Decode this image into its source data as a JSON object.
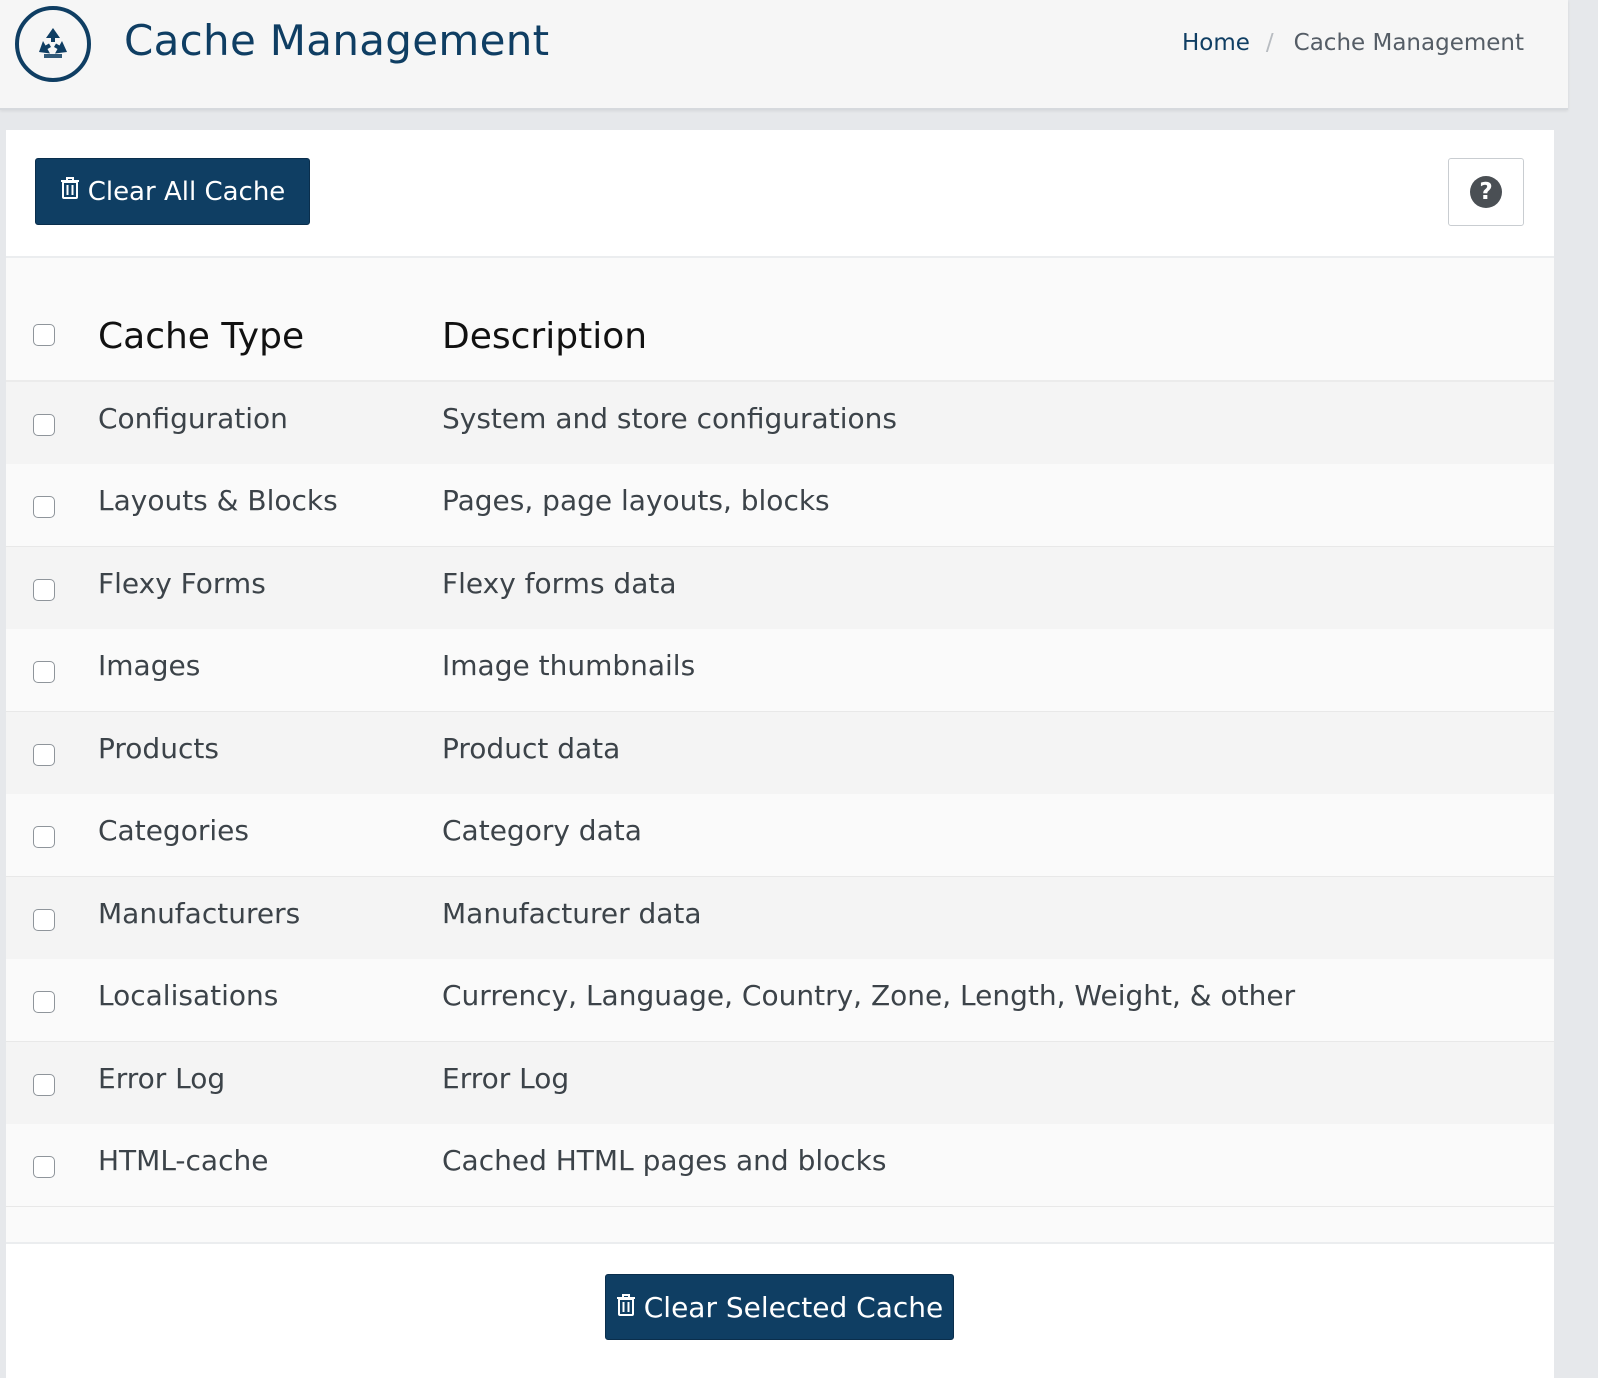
{
  "header": {
    "title": "Cache Management",
    "icon": "recycle-icon",
    "breadcrumb": {
      "home": "Home",
      "separator": "/",
      "current": "Cache Management"
    }
  },
  "toolbar": {
    "clear_all_label": "Clear All Cache",
    "clear_all_icon": "trash-icon",
    "help_icon": "question-circle-icon"
  },
  "table": {
    "columns": [
      "Cache Type",
      "Description"
    ],
    "rows": [
      {
        "type": "Configuration",
        "description": "System and store configurations",
        "checked": false
      },
      {
        "type": "Layouts & Blocks",
        "description": "Pages, page layouts, blocks",
        "checked": false
      },
      {
        "type": "Flexy Forms",
        "description": "Flexy forms data",
        "checked": false
      },
      {
        "type": "Images",
        "description": "Image thumbnails",
        "checked": false
      },
      {
        "type": "Products",
        "description": "Product data",
        "checked": false
      },
      {
        "type": "Categories",
        "description": "Category data",
        "checked": false
      },
      {
        "type": "Manufacturers",
        "description": "Manufacturer data",
        "checked": false
      },
      {
        "type": "Localisations",
        "description": "Currency, Language, Country, Zone, Length, Weight, & other",
        "checked": false
      },
      {
        "type": "Error Log",
        "description": "Error Log",
        "checked": false
      },
      {
        "type": "HTML-cache",
        "description": "Cached HTML pages and blocks",
        "checked": false
      }
    ]
  },
  "footer": {
    "clear_selected_label": "Clear Selected Cache"
  },
  "colors": {
    "primary": "#0f3e63",
    "page_bg": "#e6e8eb",
    "row_alt": "#f4f4f4"
  }
}
